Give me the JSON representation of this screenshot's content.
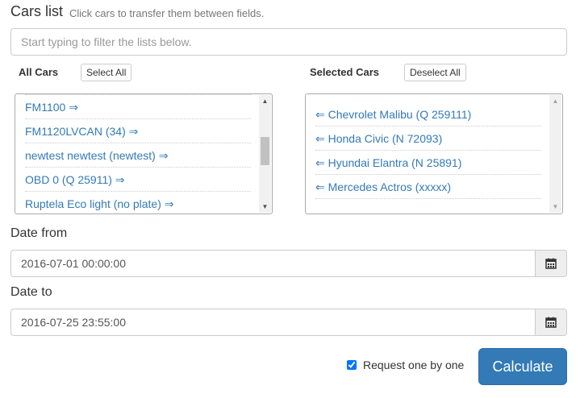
{
  "header": {
    "title": "Cars list",
    "subtitle": "Click cars to transfer them between fields."
  },
  "filter": {
    "placeholder": "Start typing to filter the lists below.",
    "value": ""
  },
  "all_cars": {
    "heading": "All Cars",
    "select_all_label": "Select All",
    "items": [
      "FM1100 ⇒",
      "FM1120LVCAN (34) ⇒",
      "newtest newtest (newtest) ⇒",
      "OBD 0 (Q 25911) ⇒",
      "Ruptela Eco light (no plate) ⇒"
    ]
  },
  "selected_cars": {
    "heading": "Selected Cars",
    "deselect_all_label": "Deselect All",
    "items": [
      "⇐ Chevrolet Malibu (Q 259111)",
      "⇐ Honda Civic (N 72093)",
      "⇐ Hyundai Elantra (N 25891)",
      "⇐ Mercedes Actros (xxxxx)"
    ]
  },
  "date_from": {
    "label": "Date from",
    "value": "2016-07-01 00:00:00"
  },
  "date_to": {
    "label": "Date to",
    "value": "2016-07-25 23:55:00"
  },
  "footer": {
    "request_one_by_one_label": "Request one by one",
    "request_one_by_one_checked": true,
    "calculate_label": "Calculate"
  },
  "colors": {
    "link": "#337ab7",
    "primary_button": "#337ab7"
  }
}
